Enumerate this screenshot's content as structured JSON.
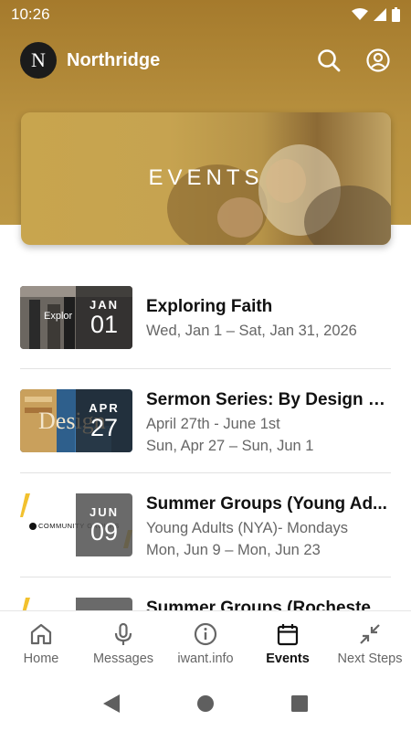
{
  "status": {
    "time": "10:26"
  },
  "app": {
    "title": "Northridge",
    "logo_letter": "N"
  },
  "banner": {
    "title": "EVENTS"
  },
  "events": [
    {
      "title": "Exploring Faith",
      "line1": "Wed, Jan 1 – Sat, Jan 31, 2026",
      "line2": "",
      "month": "JAN",
      "day": "01",
      "thumb_text": "Explor"
    },
    {
      "title": "Sermon Series: By Design - ...",
      "line1": "April 27th - June 1st",
      "line2": "Sun, Apr 27 – Sun, Jun 1",
      "month": "APR",
      "day": "27",
      "thumb_text": "Design"
    },
    {
      "title": "Summer Groups (Young Ad...",
      "line1": "Young Adults (NYA)- Mondays",
      "line2": "Mon, Jun 9 – Mon, Jun 23",
      "month": "JUN",
      "day": "09",
      "thumb_text": "COMMUNITY GROUPS"
    },
    {
      "title": "Summer Groups (Rochester...",
      "line1": "",
      "line2": "",
      "month": "",
      "day": "",
      "thumb_text": ""
    }
  ],
  "nav": [
    {
      "label": "Home",
      "icon": "home-icon",
      "active": false
    },
    {
      "label": "Messages",
      "icon": "microphone-icon",
      "active": false
    },
    {
      "label": "iwant.info",
      "icon": "info-icon",
      "active": false
    },
    {
      "label": "Events",
      "icon": "calendar-icon",
      "active": true
    },
    {
      "label": "Next Steps",
      "icon": "collapse-arrows-icon",
      "active": false
    }
  ],
  "colors": {
    "brand_gold": "#b08633",
    "active_nav": "#111111"
  }
}
